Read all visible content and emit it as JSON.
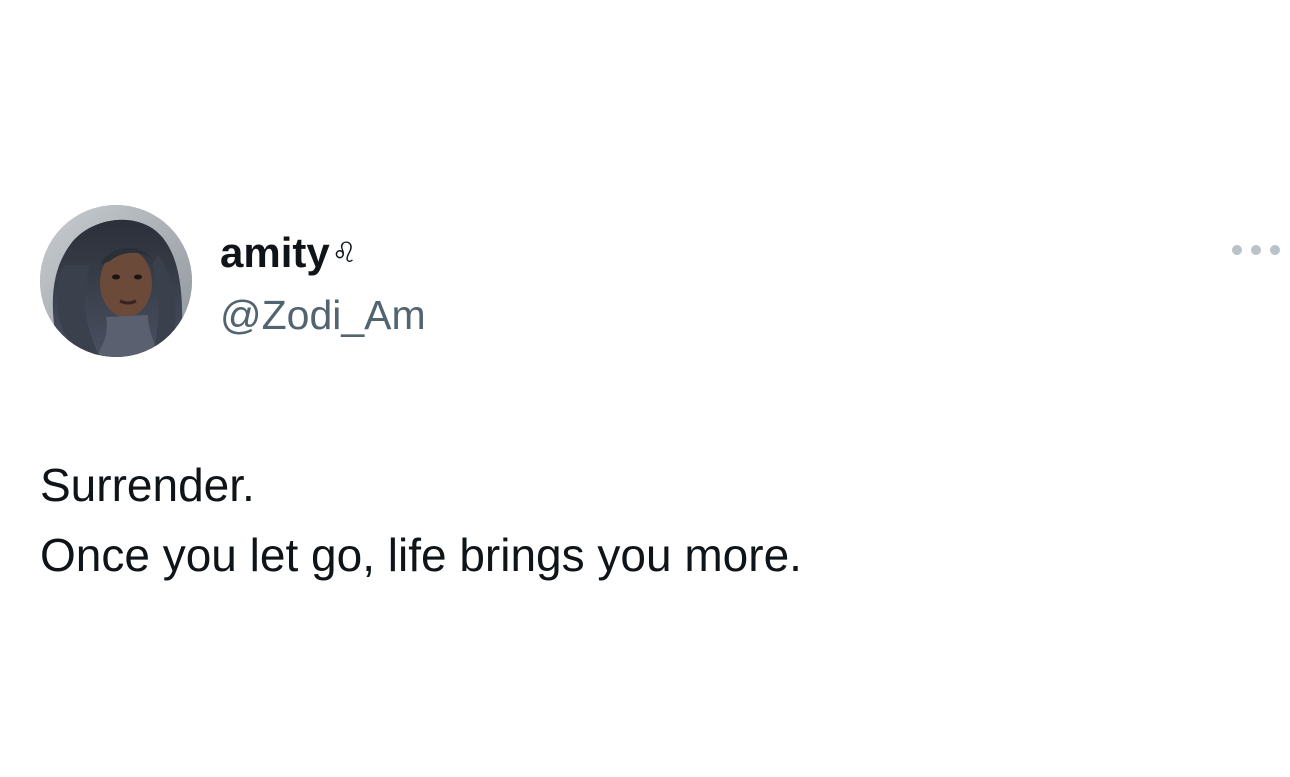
{
  "author": {
    "display_name": "amity",
    "zodiac_symbol": "♌",
    "handle": "@Zodi_Am",
    "avatar_icon": "profile-photo"
  },
  "menu": {
    "more_icon": "more-options-icon"
  },
  "tweet": {
    "lines": [
      "Surrender.",
      "Once you let go, life brings you more."
    ]
  },
  "colors": {
    "text_primary": "#0f1419",
    "text_secondary": "#536471",
    "more_dots": "#b9c1c9",
    "background": "#ffffff"
  }
}
